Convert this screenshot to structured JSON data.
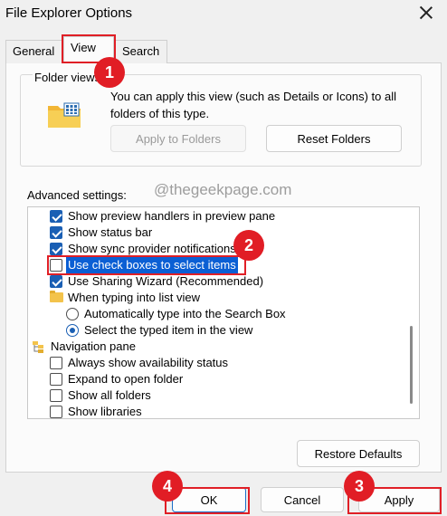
{
  "window": {
    "title": "File Explorer Options"
  },
  "tabs": [
    {
      "label": "General"
    },
    {
      "label": "View"
    },
    {
      "label": "Search"
    }
  ],
  "folder_views": {
    "label": "Folder views",
    "description": "You can apply this view (such as Details or Icons) to all folders of this type.",
    "apply_button": "Apply to Folders",
    "reset_button": "Reset Folders"
  },
  "advanced": {
    "label": "Advanced settings:",
    "items": [
      {
        "type": "checkbox",
        "label": "Show preview handlers in preview pane",
        "checked": true
      },
      {
        "type": "checkbox",
        "label": "Show status bar",
        "checked": true
      },
      {
        "type": "checkbox",
        "label": "Show sync provider notifications",
        "checked": true
      },
      {
        "type": "checkbox",
        "label": "Use check boxes to select items",
        "checked": false,
        "highlighted": true
      },
      {
        "type": "checkbox",
        "label": "Use Sharing Wizard (Recommended)",
        "checked": true
      },
      {
        "type": "folder",
        "label": "When typing into list view"
      },
      {
        "type": "radio",
        "label": "Automatically type into the Search Box",
        "selected": false
      },
      {
        "type": "radio",
        "label": "Select the typed item in the view",
        "selected": true
      },
      {
        "type": "group",
        "label": "Navigation pane"
      },
      {
        "type": "checkbox",
        "label": "Always show availability status",
        "checked": false
      },
      {
        "type": "checkbox",
        "label": "Expand to open folder",
        "checked": false
      },
      {
        "type": "checkbox",
        "label": "Show all folders",
        "checked": false
      },
      {
        "type": "checkbox",
        "label": "Show libraries",
        "checked": false
      }
    ]
  },
  "watermark": "@thegeekpage.com",
  "buttons": {
    "restore_defaults": "Restore Defaults",
    "ok": "OK",
    "cancel": "Cancel",
    "apply": "Apply"
  },
  "markers": [
    "1",
    "2",
    "3",
    "4"
  ],
  "colors": {
    "accent": "#1a5fb4",
    "highlight": "#0b5fd4",
    "annotation_red": "#e01f26"
  }
}
